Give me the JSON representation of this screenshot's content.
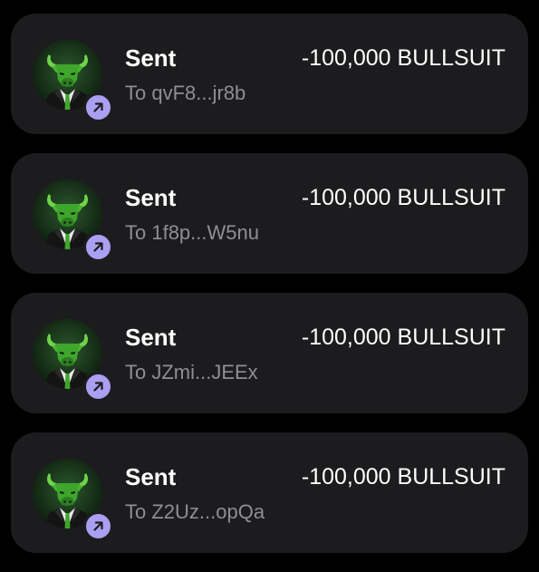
{
  "colors": {
    "background": "#000000",
    "card": "#1c1c1e",
    "title_text": "#ffffff",
    "subtitle_text": "#8e8e93",
    "badge": "#ab9ff2",
    "logo_green": "#3fa62c"
  },
  "icons": {
    "token_logo": "bull-in-suit-logo",
    "badge": "arrow-up-right-icon"
  },
  "transactions": [
    {
      "title": "Sent",
      "recipient": "To qvF8...jr8b",
      "amount": "-100,000 BULLSUIT"
    },
    {
      "title": "Sent",
      "recipient": "To 1f8p...W5nu",
      "amount": "-100,000 BULLSUIT"
    },
    {
      "title": "Sent",
      "recipient": "To JZmi...JEEx",
      "amount": "-100,000 BULLSUIT"
    },
    {
      "title": "Sent",
      "recipient": "To Z2Uz...opQa",
      "amount": "-100,000 BULLSUIT"
    }
  ]
}
